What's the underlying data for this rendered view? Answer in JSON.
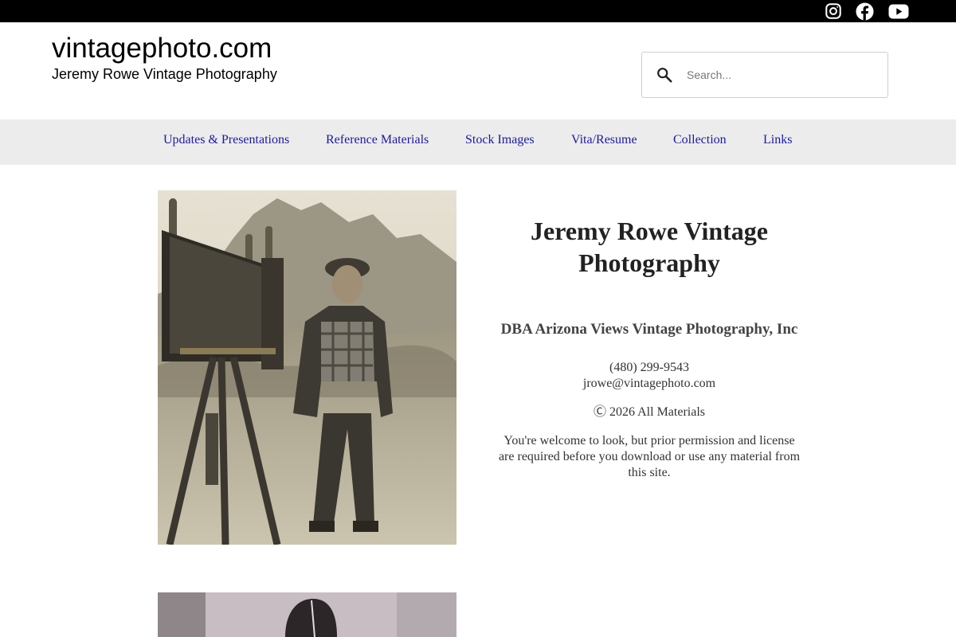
{
  "social": {
    "icons": [
      "instagram-icon",
      "facebook-icon",
      "youtube-icon"
    ]
  },
  "header": {
    "site_title": "vintagephoto.com",
    "tagline": "Jeremy Rowe Vintage Photography"
  },
  "search": {
    "placeholder": "Search...",
    "value": ""
  },
  "nav": {
    "items": [
      {
        "label": "Updates & Presentations"
      },
      {
        "label": "Reference Materials"
      },
      {
        "label": "Stock Images"
      },
      {
        "label": "Vita/Resume"
      },
      {
        "label": "Collection"
      },
      {
        "label": "Links"
      }
    ]
  },
  "main": {
    "title": "Jeremy Rowe Vintage Photography",
    "dba": "DBA Arizona Views Vintage Photography, Inc",
    "phone": "(480) 299-9543",
    "email": "jrowe@vintagephoto.com",
    "copyright": "Ⓒ 2026 All Materials",
    "notice": "You're welcome to look, but prior permission and license are required before you download or use any material from this site."
  },
  "colors": {
    "topbar": "#000000",
    "nav_background": "#ececec",
    "nav_link": "#1a1aa6"
  }
}
